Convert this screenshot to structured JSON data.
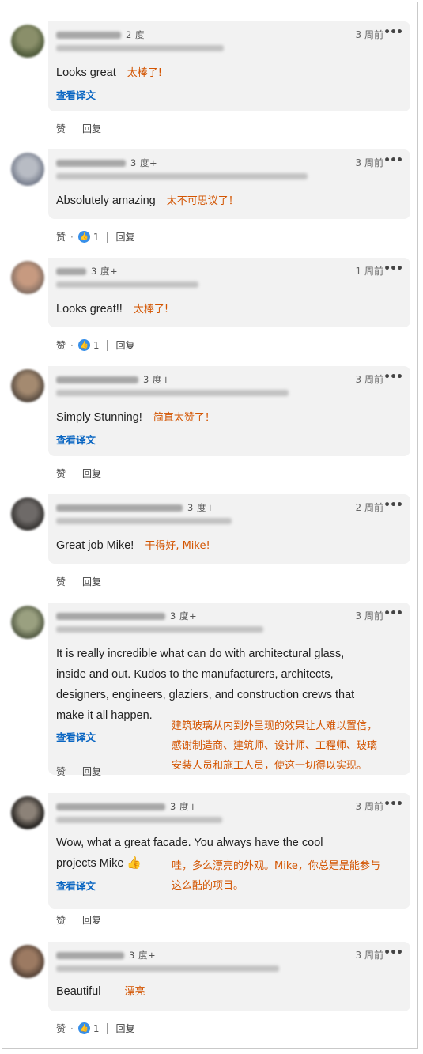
{
  "actions": {
    "like_label": "赞",
    "reply_label": "回复",
    "see_translation": "查看译文"
  },
  "comments": [
    {
      "degree": "2 度",
      "time": "3 周前",
      "text": "Looks great",
      "translation": "太棒了!",
      "likes": ""
    },
    {
      "degree": "3 度+",
      "time": "3 周前",
      "text": "Absolutely amazing",
      "translation": "太不可思议了！",
      "likes": "1"
    },
    {
      "degree": "3 度+",
      "time": "1 周前",
      "text": "Looks great!!",
      "translation": "太棒了!",
      "likes": "1"
    },
    {
      "degree": "3 度+",
      "time": "3 周前",
      "text": "Simply Stunning!",
      "translation": "简直太赞了！",
      "likes": ""
    },
    {
      "degree": "3 度+",
      "time": "2 周前",
      "text": "Great job Mike!",
      "translation": "干得好, Mike!",
      "likes": ""
    },
    {
      "degree": "3 度+",
      "time": "3 周前",
      "text_lines": [
        "It is really incredible what can do with architectural glass,",
        "inside and out. Kudos to the manufacturers, architects,",
        "designers, engineers, glaziers, and construction crews that",
        "make it all happen."
      ],
      "translation_lines": [
        "建筑玻璃从内到外呈现的效果让人难以置信，",
        "感谢制造商、建筑师、设计师、工程师、玻璃",
        "安装人员和施工人员，使这一切得以实现。"
      ],
      "likes": ""
    },
    {
      "degree": "3 度+",
      "time": "3 周前",
      "text_lines": [
        "Wow, what a great facade. You always have the cool",
        "projects Mike"
      ],
      "translation_lines": [
        "哇，多么漂亮的外观。Mike，你总是是能参与",
        "这么酷的项目。"
      ],
      "likes": ""
    },
    {
      "degree": "3 度+",
      "time": "3 周前",
      "text": "Beautiful",
      "translation": "漂亮",
      "likes": "1"
    }
  ],
  "colors": {
    "link": "#0a66c2",
    "translation": "#d35400",
    "like_blue": "#378fe9",
    "bubble": "#f2f2f2"
  },
  "icons": {
    "more": "more-dots-icon",
    "like": "like-thumb-icon",
    "thumbs_up_emoji": "thumbs-up-emoji-icon"
  },
  "more_glyph": "•••"
}
